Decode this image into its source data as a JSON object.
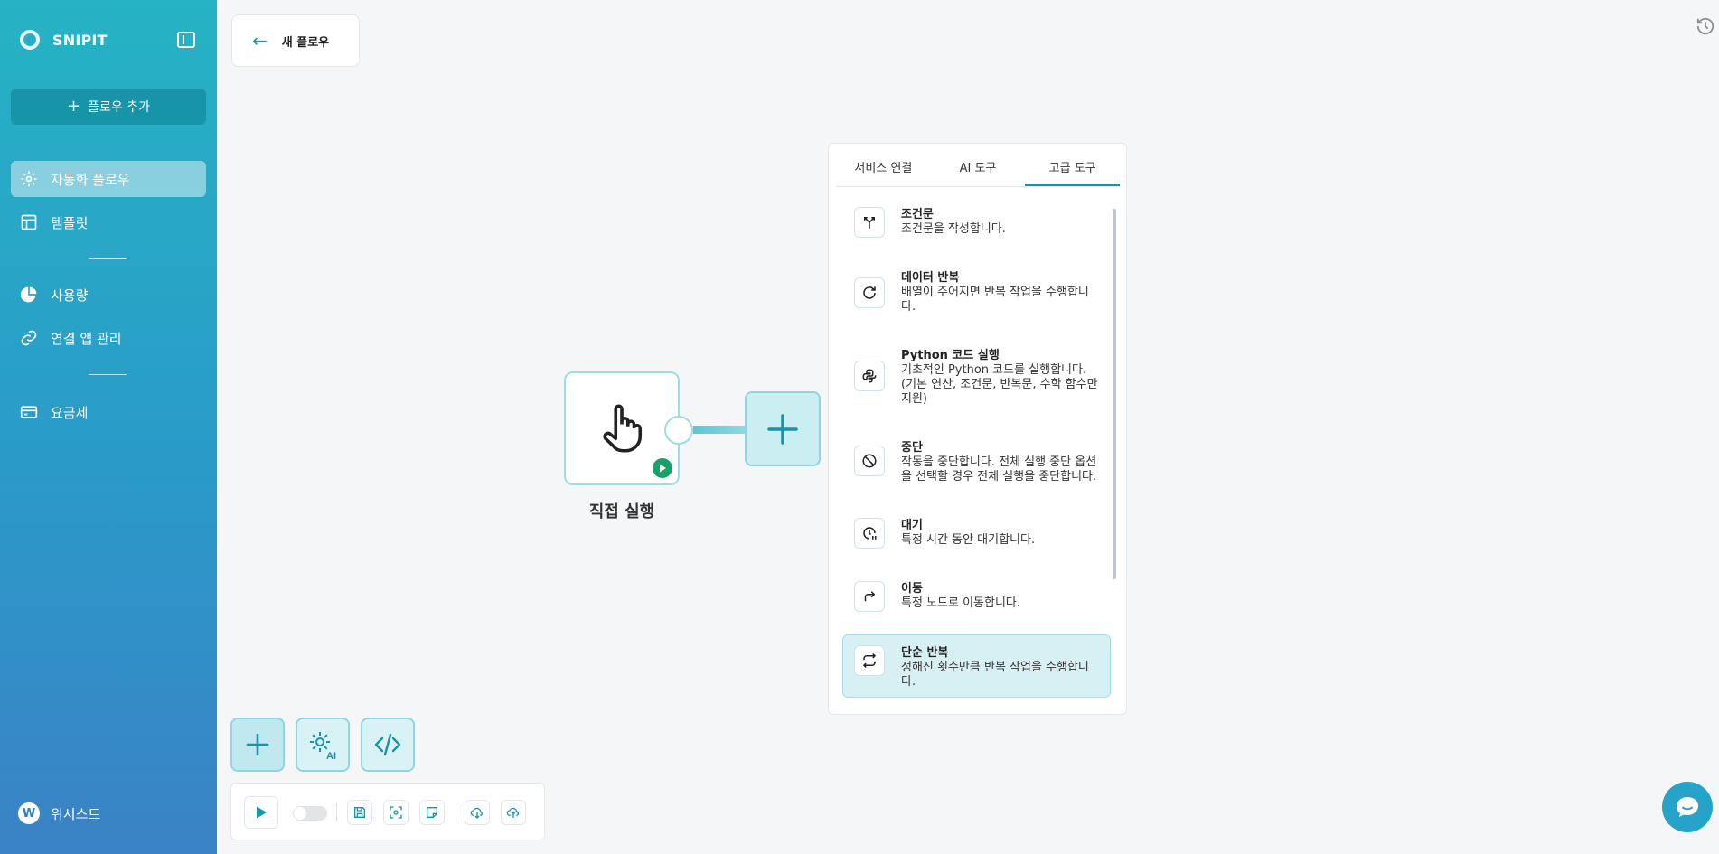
{
  "brand": {
    "name": "SNIPIT"
  },
  "sidebar": {
    "add_flow": "플로우 추가",
    "items": [
      {
        "label": "자동화 플로우",
        "icon": "gear-icon",
        "active": true
      },
      {
        "label": "템플릿",
        "icon": "template-icon"
      },
      {
        "label": "사용량",
        "icon": "pie-chart-icon"
      },
      {
        "label": "연결 앱 관리",
        "icon": "link-icon"
      },
      {
        "label": "요금제",
        "icon": "card-icon"
      }
    ],
    "footer": "위시스트"
  },
  "header": {
    "title": "새 플로우"
  },
  "canvas": {
    "trigger_node_label": "직접 실행"
  },
  "tool_panel": {
    "tabs": [
      "서비스 연결",
      "AI 도구",
      "고급 도구"
    ],
    "active_tab": "고급 도구",
    "items": [
      {
        "title": "조건문",
        "desc": "조건문을 작성합니다.",
        "icon": "branch-icon"
      },
      {
        "title": "데이터 반복",
        "desc": "배열이 주어지면 반복 작업을 수행합니다.",
        "icon": "refresh-icon"
      },
      {
        "title": "Python 코드 실행",
        "desc": "기초적인 Python 코드를 실행합니다. (기본 연산, 조건문, 반복문, 수학 함수만 지원)",
        "icon": "python-icon"
      },
      {
        "title": "중단",
        "desc": "작동을 중단합니다. 전체 실행 중단 옵션을 선택할 경우 전체 실행을 중단합니다.",
        "icon": "stop-icon"
      },
      {
        "title": "대기",
        "desc": "특정 시간 동안 대기합니다.",
        "icon": "clock-pause-icon"
      },
      {
        "title": "이동",
        "desc": "특정 노드로 이동합니다.",
        "icon": "redirect-icon"
      },
      {
        "title": "단순 반복",
        "desc": "정해진 횟수만큼 반복 작업을 수행합니다.",
        "icon": "repeat-icon",
        "highlighted": true
      }
    ]
  },
  "colors": {
    "accent": "#1794a8",
    "sidebar_top": "#26b3c4",
    "sidebar_bottom": "#3b82c6",
    "highlight": "#d6f0f4"
  }
}
